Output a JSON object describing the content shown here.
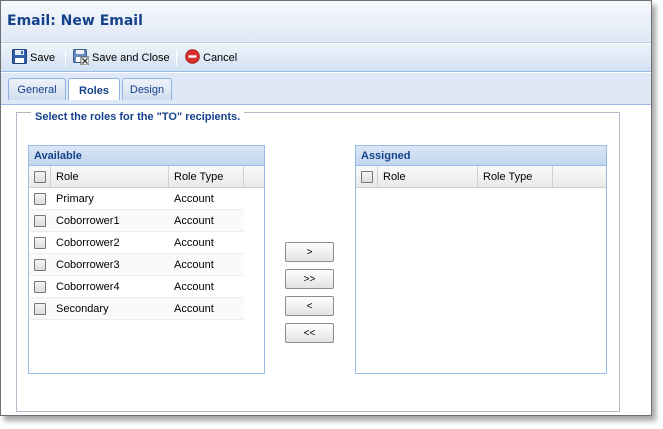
{
  "window": {
    "title": "Email: New Email"
  },
  "toolbar": {
    "save_label": "Save",
    "save_close_label": "Save and Close",
    "cancel_label": "Cancel"
  },
  "tabs": [
    {
      "label": "General"
    },
    {
      "label": "Roles",
      "active": true
    },
    {
      "label": "Design"
    }
  ],
  "roles_section": {
    "legend": "Select the roles for the \"TO\" recipients."
  },
  "available": {
    "title": "Available",
    "columns": [
      "Role",
      "Role Type"
    ],
    "rows": [
      {
        "role": "Primary",
        "type": "Account"
      },
      {
        "role": "Coborrower1",
        "type": "Account"
      },
      {
        "role": "Coborrower2",
        "type": "Account"
      },
      {
        "role": "Coborrower3",
        "type": "Account"
      },
      {
        "role": "Coborrower4",
        "type": "Account"
      },
      {
        "role": "Secondary",
        "type": "Account"
      }
    ]
  },
  "assigned": {
    "title": "Assigned",
    "columns": [
      "Role",
      "Role Type"
    ],
    "rows": []
  },
  "move_buttons": {
    "add": ">",
    "add_all": ">>",
    "remove": "<",
    "remove_all": "<<"
  },
  "colors": {
    "header_text": "#15428b",
    "border_blue": "#99bbe8",
    "cancel_red": "#d9302b"
  },
  "icons": {
    "save": "floppy-disk-icon",
    "save_close": "floppy-disk-close-icon",
    "cancel": "cancel-circle-icon"
  }
}
